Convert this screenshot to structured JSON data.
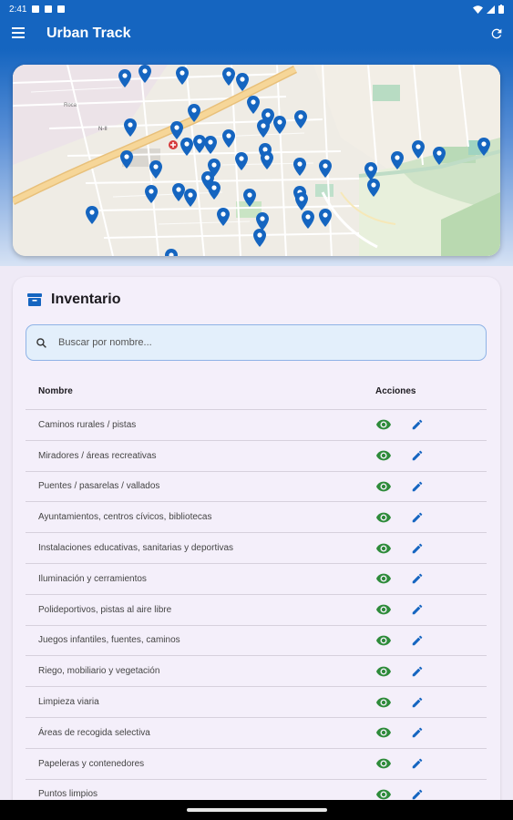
{
  "status_bar": {
    "time": "2:41"
  },
  "app_bar": {
    "title": "Urban Track",
    "menu_icon": "menu-icon",
    "refresh_icon": "refresh-icon"
  },
  "colors": {
    "primary": "#1565c0",
    "eye": "#2e8b3a",
    "pencil": "#1565c0",
    "marker": "#1565c0"
  },
  "map": {
    "labels": {
      "road": "N-II",
      "district": "Roca"
    }
  },
  "inventory": {
    "title": "Inventario",
    "search": {
      "placeholder": "Buscar por nombre...",
      "value": ""
    },
    "columns": {
      "name": "Nombre",
      "actions": "Acciones"
    },
    "rows": [
      {
        "name": "Caminos rurales / pistas"
      },
      {
        "name": "Miradores / áreas recreativas"
      },
      {
        "name": "Puentes / pasarelas / vallados"
      },
      {
        "name": "Ayuntamientos, centros cívicos, bibliotecas"
      },
      {
        "name": "Instalaciones educativas, sanitarias y deportivas"
      },
      {
        "name": "Iluminación y cerramientos"
      },
      {
        "name": "Polideportivos, pistas al aire libre"
      },
      {
        "name": "Juegos infantiles, fuentes, caminos"
      },
      {
        "name": "Riego, mobiliario y vegetación"
      },
      {
        "name": "Limpieza viaria"
      },
      {
        "name": "Áreas de recogida selectiva"
      },
      {
        "name": "Papeleras y contenedores"
      },
      {
        "name": "Puntos limpios"
      }
    ]
  }
}
